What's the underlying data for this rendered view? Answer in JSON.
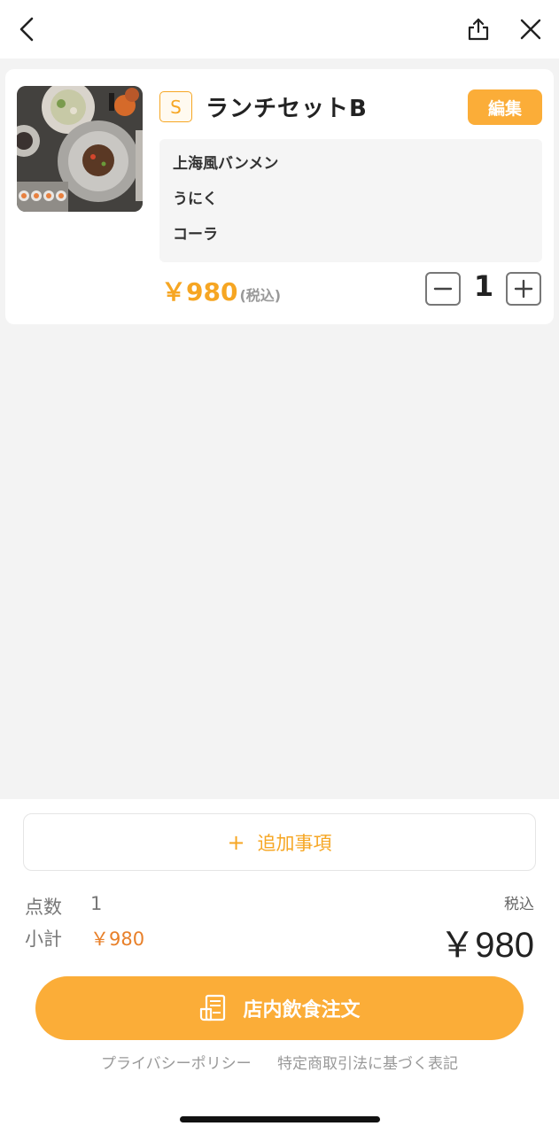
{
  "header": {
    "back_icon": "chevron-left-icon",
    "share_icon": "share-icon",
    "close_icon": "close-icon"
  },
  "cart_item": {
    "size": "S",
    "name": "ランチセットB",
    "edit_label": "編集",
    "options": [
      "上海風バンメン",
      "うにく",
      "コーラ"
    ],
    "price": "￥980",
    "price_tax_label": "(税込)",
    "quantity": "1"
  },
  "add_items": {
    "plus": "+",
    "label": "追加事項"
  },
  "summary": {
    "count_label": "点数",
    "count_value": "1",
    "subtotal_label": "小計",
    "subtotal_value": "￥980",
    "tax_label": "税込",
    "total": "￥980"
  },
  "order_button": {
    "label": "店内飲食注文",
    "icon": "receipt-icon"
  },
  "footer": {
    "privacy": "プライバシーポリシー",
    "legal": "特定商取引法に基づく表記"
  },
  "colors": {
    "accent": "#fbad38",
    "price": "#f6a623",
    "subtotal": "#e8802a"
  }
}
